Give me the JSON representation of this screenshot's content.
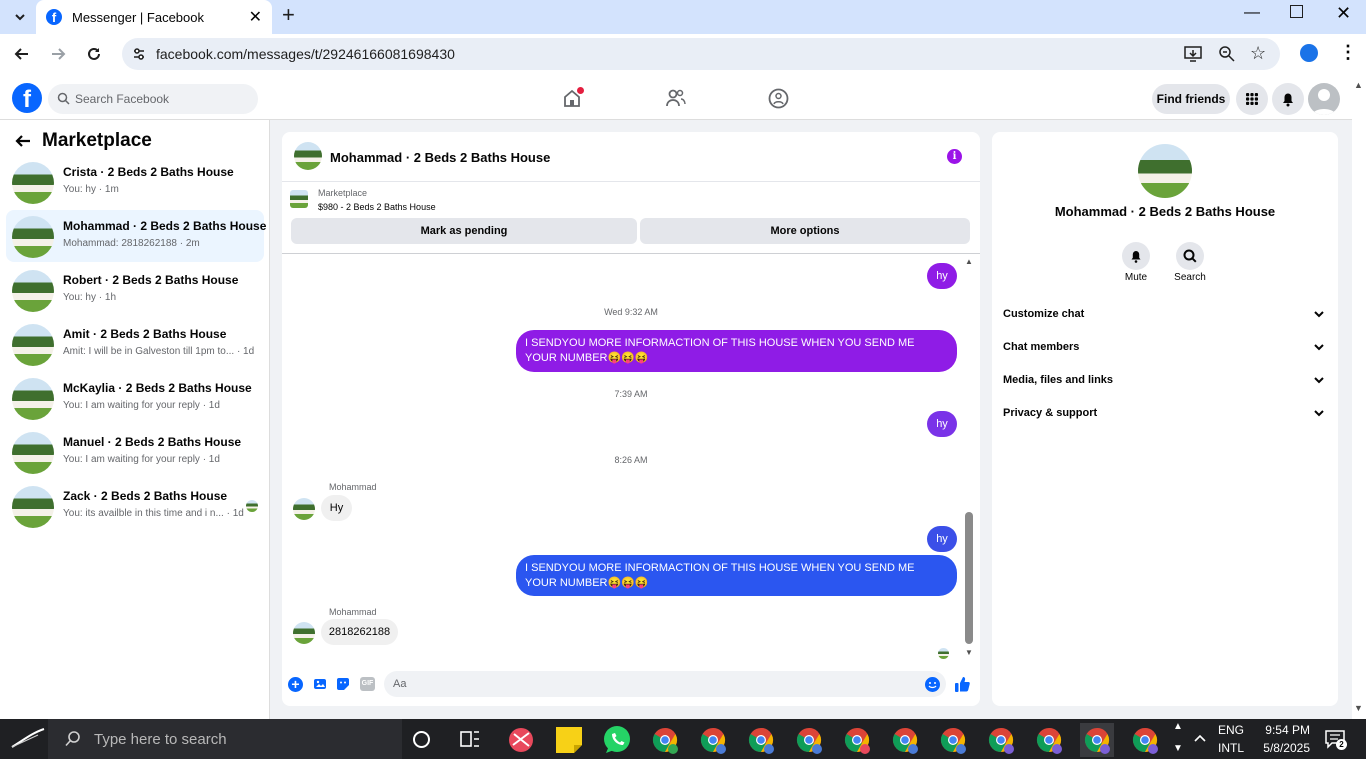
{
  "browser": {
    "tab_title": "Messenger | Facebook",
    "url": "facebook.com/messages/t/29246166081698430"
  },
  "fb": {
    "search_placeholder": "Search Facebook",
    "find_friends": "Find friends",
    "brand_color": "#0866ff"
  },
  "left": {
    "title": "Marketplace",
    "conversations": [
      {
        "name": "Crista · 2 Beds 2 Baths House",
        "preview": "You: hy · 1m"
      },
      {
        "name": "Mohammad · 2 Beds 2 Baths House",
        "preview": "Mohammad: 2818262188 · 2m"
      },
      {
        "name": "Robert · 2 Beds 2 Baths House",
        "preview": "You: hy · 1h"
      },
      {
        "name": "Amit · 2 Beds 2 Baths House",
        "preview": "Amit: I will be in Galveston till 1pm to... · 1d"
      },
      {
        "name": "McKaylia · 2 Beds 2 Baths House",
        "preview": "You: I am waiting for your reply · 1d"
      },
      {
        "name": "Manuel · 2 Beds 2 Baths House",
        "preview": "You: I am waiting for your reply · 1d"
      },
      {
        "name": "Zack · 2 Beds 2 Baths House",
        "preview": "You: its availble in this time and i n... · 1d"
      }
    ]
  },
  "chat": {
    "title": "Mohammad · 2 Beds 2 Baths House",
    "listing_label": "Marketplace",
    "listing_title": "$980 - 2 Beds 2 Baths House",
    "mark_pending": "Mark as pending",
    "more_options": "More options",
    "messages": {
      "m1": "hy",
      "t1": "Wed 9:32 AM",
      "m2": "I SENDYOU MORE INFORMACTION OF THIS HOUSE  WHEN YOU SEND ME  YOUR NUMBER😝😝😝",
      "t2": "7:39 AM",
      "m3": "hy",
      "t3": "8:26 AM",
      "sender1": "Mohammad",
      "m4": "Hy",
      "m5": "hy",
      "m6": "I SENDYOU MORE INFORMACTION OF THIS HOUSE  WHEN YOU SEND ME  YOUR NUMBER😝😝😝",
      "sender2": "Mohammad",
      "m7": "2818262188"
    },
    "composer_placeholder": "Aa",
    "gif_label": "GIF"
  },
  "right": {
    "name": "Mohammad · 2 Beds 2 Baths House",
    "mute": "Mute",
    "search": "Search",
    "sections": [
      "Customize chat",
      "Chat members",
      "Media, files and links",
      "Privacy & support"
    ]
  },
  "taskbar": {
    "search_placeholder": "Type here to search",
    "lang1": "ENG",
    "lang2": "INTL",
    "time": "9:54 PM",
    "date": "5/8/2025"
  }
}
